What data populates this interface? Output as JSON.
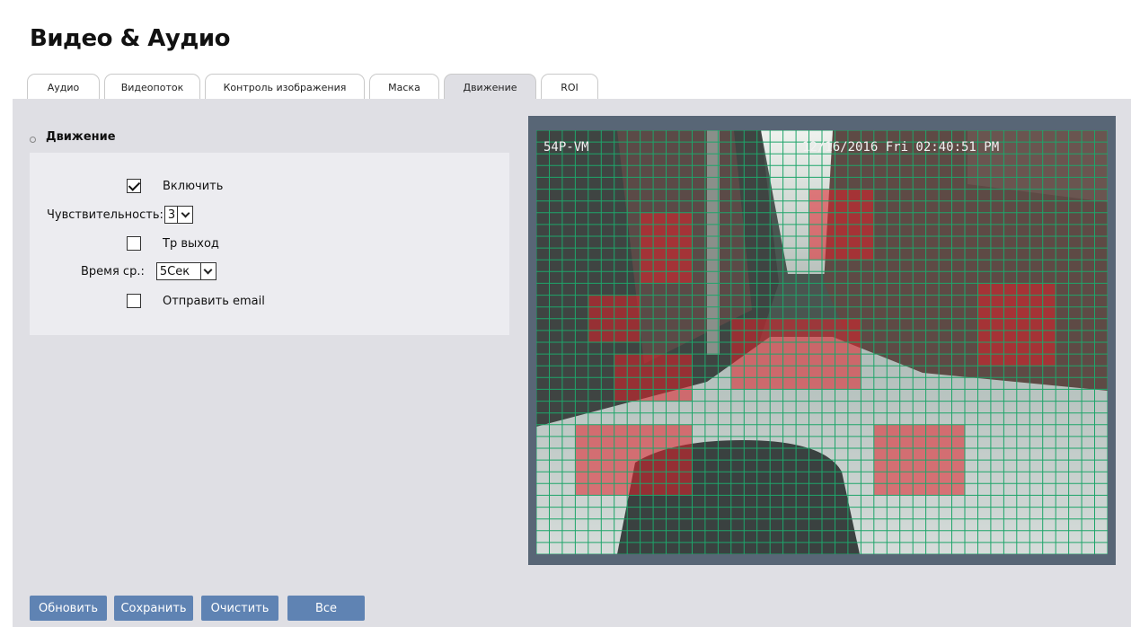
{
  "page": {
    "title": "Видео & Аудио"
  },
  "tabs": [
    {
      "label": "Аудио",
      "active": false
    },
    {
      "label": "Видеопоток",
      "active": false
    },
    {
      "label": "Контроль изображения",
      "active": false
    },
    {
      "label": "Маска",
      "active": false
    },
    {
      "label": "Движение",
      "active": true
    },
    {
      "label": "ROI",
      "active": false
    }
  ],
  "section": {
    "title": "Движение"
  },
  "form": {
    "enable": {
      "label": "Включить",
      "checked": true
    },
    "sensitivity": {
      "label": "Чувствительность:",
      "value": "3"
    },
    "trigger_out": {
      "label": "Tp выход",
      "checked": false
    },
    "interval": {
      "label": "Время ср.:",
      "value": "5Сек"
    },
    "send_email": {
      "label": "Отправить email",
      "checked": false
    }
  },
  "video": {
    "camera_name": "54P-VM",
    "timestamp": "12/16/2016 Fri 02:40:51 PM",
    "grid_color": "#1ea56a",
    "motion_color": "#e0202a"
  },
  "buttons": {
    "refresh": "Обновить",
    "save": "Сохранить",
    "clear": "Очистить",
    "all": "Все"
  },
  "colors": {
    "button_bg": "#5f83b3",
    "panel_bg": "#dfdfe4",
    "frame_bg": "#586676"
  }
}
